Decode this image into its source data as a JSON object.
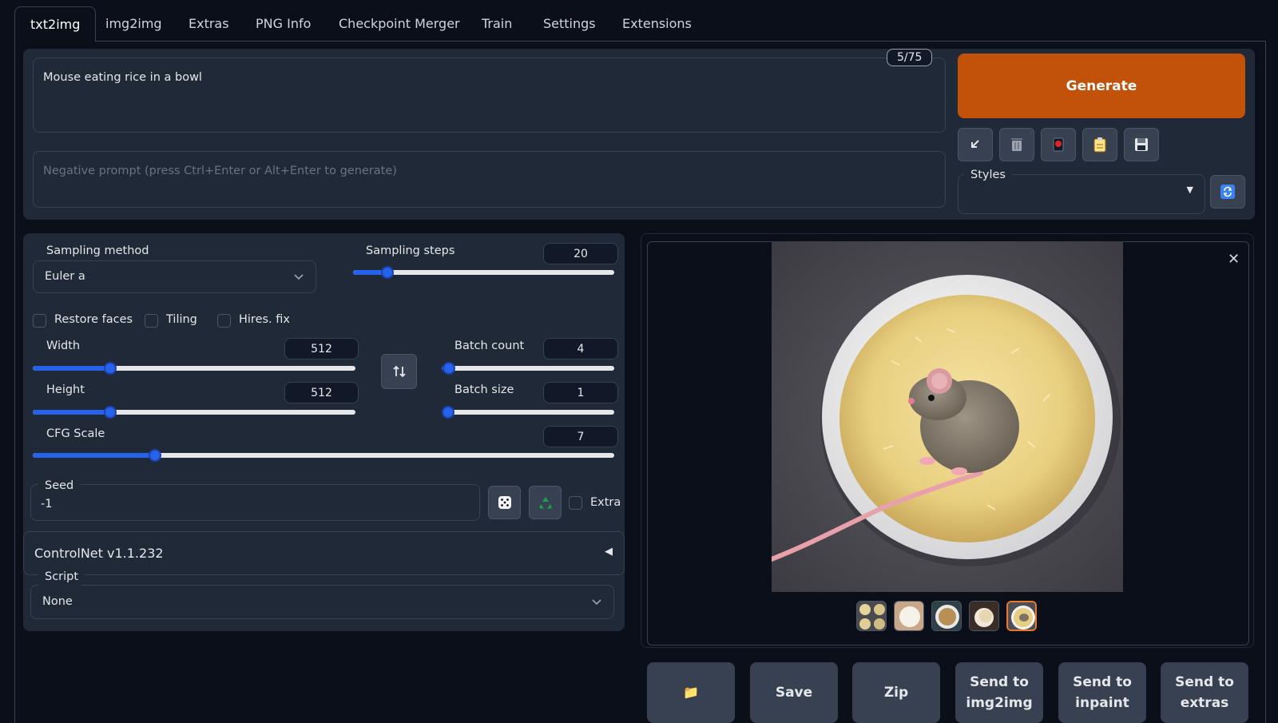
{
  "tabs": [
    {
      "label": "txt2img",
      "active": true
    },
    {
      "label": "img2img"
    },
    {
      "label": "Extras"
    },
    {
      "label": "PNG Info"
    },
    {
      "label": "Checkpoint Merger"
    },
    {
      "label": "Train"
    },
    {
      "label": "Settings"
    },
    {
      "label": "Extensions"
    }
  ],
  "prompt": {
    "value": "Mouse eating rice in a bowl",
    "token_counter": "5/75",
    "negative_placeholder": "Negative prompt (press Ctrl+Enter or Alt+Enter to generate)"
  },
  "generate": {
    "label": "Generate",
    "color": "#c2510a"
  },
  "tools": [
    "arrow-down-left-icon",
    "trash-icon",
    "red-button-icon",
    "clipboard-icon",
    "floppy-disk-icon"
  ],
  "styles": {
    "label": "Styles",
    "value": ""
  },
  "sampling": {
    "method_label": "Sampling method",
    "method_value": "Euler a",
    "steps_label": "Sampling steps",
    "steps_value": "20",
    "steps_fraction": 0.13
  },
  "checkboxes": {
    "restore_faces": "Restore faces",
    "tiling": "Tiling",
    "hires_fix": "Hires. fix"
  },
  "width": {
    "label": "Width",
    "value": "512",
    "fraction": 0.24
  },
  "height": {
    "label": "Height",
    "value": "512",
    "fraction": 0.24
  },
  "batch_count": {
    "label": "Batch count",
    "value": "4",
    "fraction": 0.04
  },
  "batch_size": {
    "label": "Batch size",
    "value": "1",
    "fraction": 0.0
  },
  "cfg": {
    "label": "CFG Scale",
    "value": "7",
    "fraction": 0.21
  },
  "seed": {
    "label": "Seed",
    "value": "-1",
    "extra_label": "Extra"
  },
  "controlnet": {
    "label": "ControlNet v1.1.232"
  },
  "script": {
    "label": "Script",
    "value": "None"
  },
  "output_buttons": {
    "folder": "📁",
    "save": "Save",
    "zip": "Zip",
    "img2img_1": "Send to",
    "img2img_2": "img2img",
    "inpaint_1": "Send to",
    "inpaint_2": "inpaint",
    "extras_1": "Send to",
    "extras_2": "extras"
  },
  "gallery": {
    "thumbnail_count": 5,
    "selected_index": 4
  }
}
